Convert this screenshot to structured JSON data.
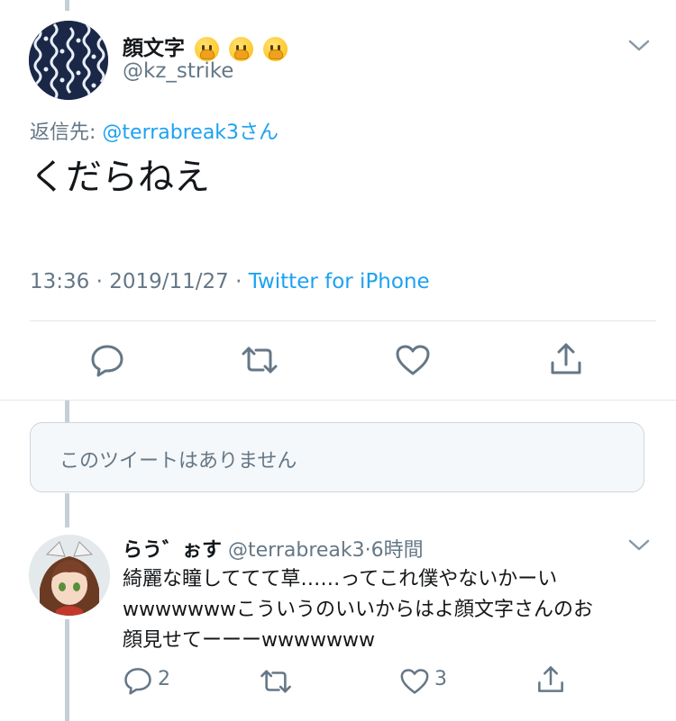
{
  "main_tweet": {
    "display_name": "顔文字",
    "emojis": [
      "shushing-face-emoji",
      "shushing-face-emoji",
      "shushing-face-emoji"
    ],
    "handle": "@kz_strike",
    "reply_prefix": "返信先: ",
    "reply_to": "@terrabreak3",
    "reply_suffix": "さん",
    "text": "くだらねえ",
    "time": "13:36 · 2019/11/27 · ",
    "client": "Twitter for iPhone"
  },
  "deleted_tweet": {
    "text": "このツイートはありません"
  },
  "reply_tweet": {
    "display_name": "らう゛ぉす",
    "handle": "@terrabreak3",
    "separator": "·",
    "time_ago": "6時間",
    "lines": [
      "綺麗な瞳しててて草……ってこれ僕やないかーい",
      "wwwwwwwこういうのいいからはよ顔文字さんのお",
      "顔見せてーーーwwwwwww"
    ],
    "reply_count": "2",
    "like_count": "3"
  },
  "colors": {
    "link": "#1da1f2",
    "muted": "#657786",
    "thread_line": "#c4cfd6"
  }
}
